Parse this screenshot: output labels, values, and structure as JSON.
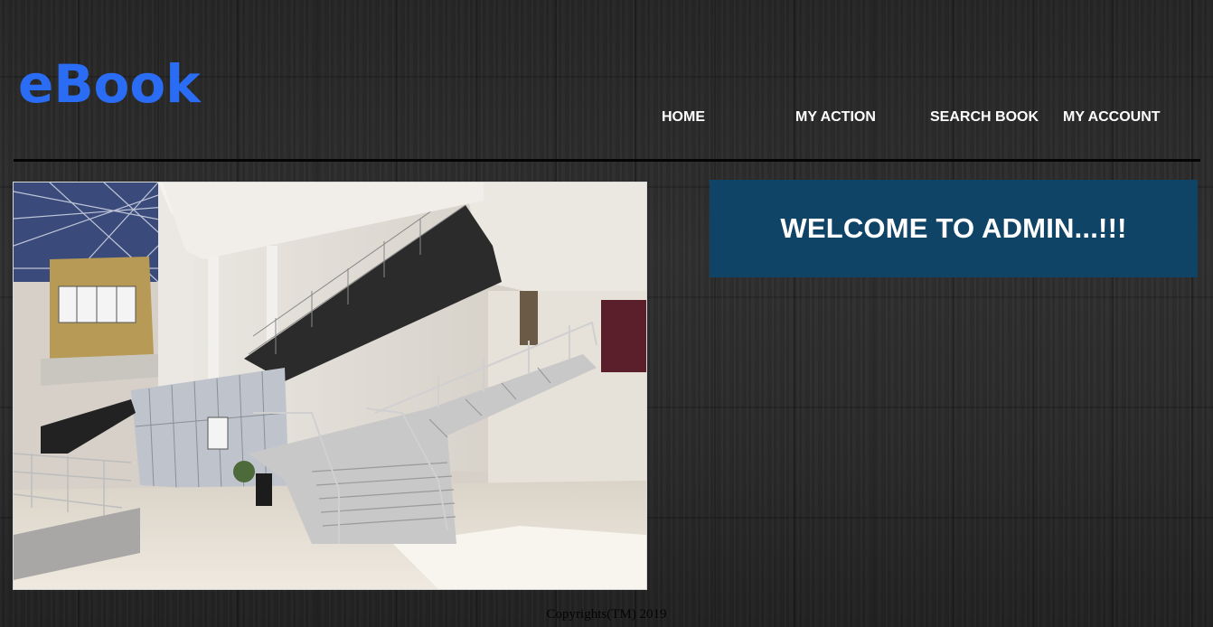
{
  "brand": {
    "title": "eBook",
    "color": "#2a6df4"
  },
  "nav": {
    "items": [
      {
        "label": "HOME"
      },
      {
        "label": "MY ACTION"
      },
      {
        "label": "SEARCH BOOK"
      },
      {
        "label": "MY ACCOUNT"
      }
    ]
  },
  "main": {
    "image_icon": "building-interior-photo",
    "welcome": "WELCOME TO ADMIN...!!!",
    "welcome_bg": "#0f4466"
  },
  "footer": {
    "copyright": "Copyrights(TM) 2019"
  }
}
